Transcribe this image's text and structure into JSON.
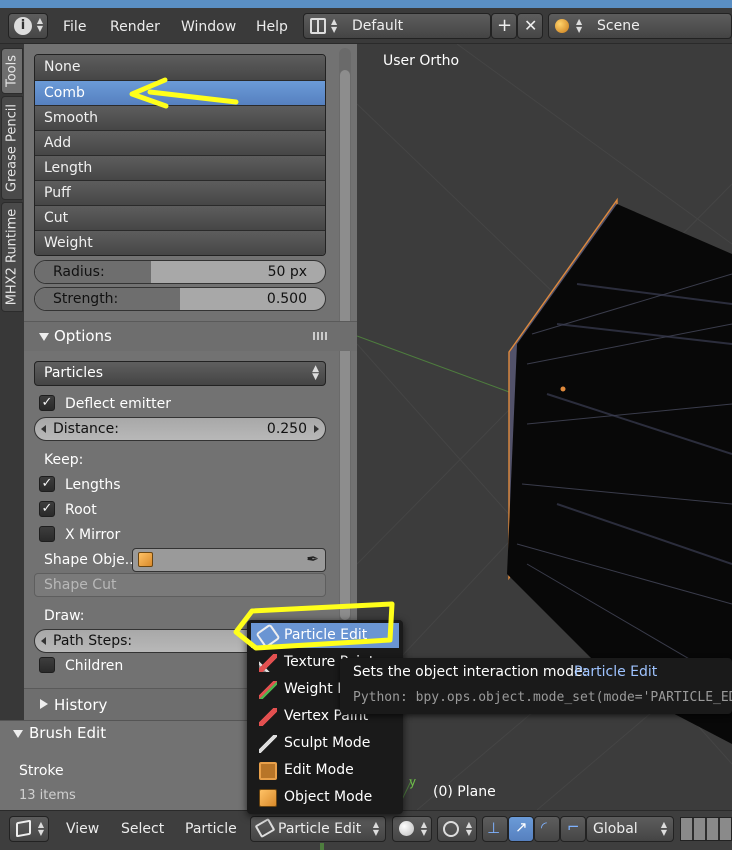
{
  "topbar": {
    "menus": [
      "File",
      "Render",
      "Window",
      "Help"
    ],
    "layout": "Default",
    "scene": "Scene"
  },
  "vtabs": [
    "Tools",
    "Grease Pencil",
    "MHX2 Runtime"
  ],
  "brushes": [
    "None",
    "Comb",
    "Smooth",
    "Add",
    "Length",
    "Puff",
    "Cut",
    "Weight"
  ],
  "selected_brush": "Comb",
  "radius": {
    "label": "Radius:",
    "value": "50 px",
    "fraction": 0.4
  },
  "strength": {
    "label": "Strength:",
    "value": "0.500",
    "fraction": 0.5
  },
  "options": {
    "header": "Options",
    "mode_select": "Particles",
    "deflect": "Deflect emitter",
    "distance_label": "Distance:",
    "distance_value": "0.250",
    "keep": "Keep:",
    "lengths": "Lengths",
    "root": "Root",
    "xmirror": "X Mirror",
    "shape_object": "Shape Obje...",
    "shape_cut": "Shape Cut",
    "draw": "Draw:",
    "path_steps": "Path Steps:",
    "children": "Children"
  },
  "history": "History",
  "brush_edit": {
    "header": "Brush Edit",
    "stroke": "Stroke",
    "items": "13 items"
  },
  "viewport": {
    "view_label": "User Ortho",
    "object_label": "(0) Plane",
    "axis_y": "y"
  },
  "mode_menu": {
    "items": [
      "Particle Edit",
      "Texture Paint",
      "Weight Paint",
      "Vertex Paint",
      "Sculpt Mode",
      "Edit Mode",
      "Object Mode"
    ],
    "selected": "Particle Edit"
  },
  "tooltip": {
    "title": "Sets the object interaction mode:",
    "mode": "Particle Edit",
    "python": "Python: bpy.ops.object.mode_set(mode='PARTICLE_EDIT')"
  },
  "bottombar": {
    "menus": [
      "View",
      "Select",
      "Particle"
    ],
    "mode": "Particle Edit",
    "orientation": "Global"
  },
  "colors": {
    "accent": "#5680bf",
    "annotation": "#ffff1a",
    "plane_edge": "#e08a3c"
  }
}
